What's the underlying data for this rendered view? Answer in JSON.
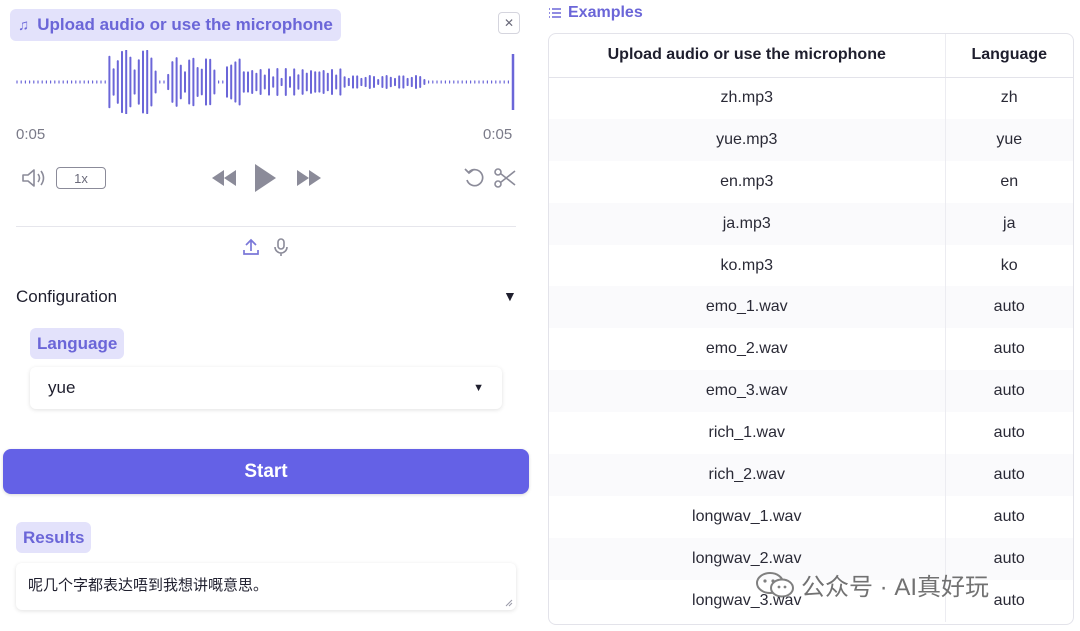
{
  "audio": {
    "label": "Upload audio or use the microphone",
    "time_current": "0:05",
    "time_total": "0:05",
    "playback_speed": "1x",
    "close_glyph": "✕"
  },
  "config": {
    "label": "Configuration",
    "caret": "▼"
  },
  "language": {
    "label": "Language",
    "value": "yue"
  },
  "start_label": "Start",
  "results": {
    "label": "Results",
    "text": "呢几个字都表达唔到我想讲嘅意思。"
  },
  "examples": {
    "label": "Examples",
    "headers": [
      "Upload audio or use the microphone",
      "Language"
    ],
    "rows": [
      [
        "zh.mp3",
        "zh"
      ],
      [
        "yue.mp3",
        "yue"
      ],
      [
        "en.mp3",
        "en"
      ],
      [
        "ja.mp3",
        "ja"
      ],
      [
        "ko.mp3",
        "ko"
      ],
      [
        "emo_1.wav",
        "auto"
      ],
      [
        "emo_2.wav",
        "auto"
      ],
      [
        "emo_3.wav",
        "auto"
      ],
      [
        "rich_1.wav",
        "auto"
      ],
      [
        "rich_2.wav",
        "auto"
      ],
      [
        "longwav_1.wav",
        "auto"
      ],
      [
        "longwav_2.wav",
        "auto"
      ],
      [
        "longwav_3.wav",
        "auto"
      ]
    ]
  },
  "watermark": {
    "text": "公众号 · AI真好玩"
  },
  "colors": {
    "accent": "#6461e6",
    "chip_bg": "#e3e2fb",
    "chip_text": "#6b66d8",
    "wave": "#6b66d8"
  }
}
